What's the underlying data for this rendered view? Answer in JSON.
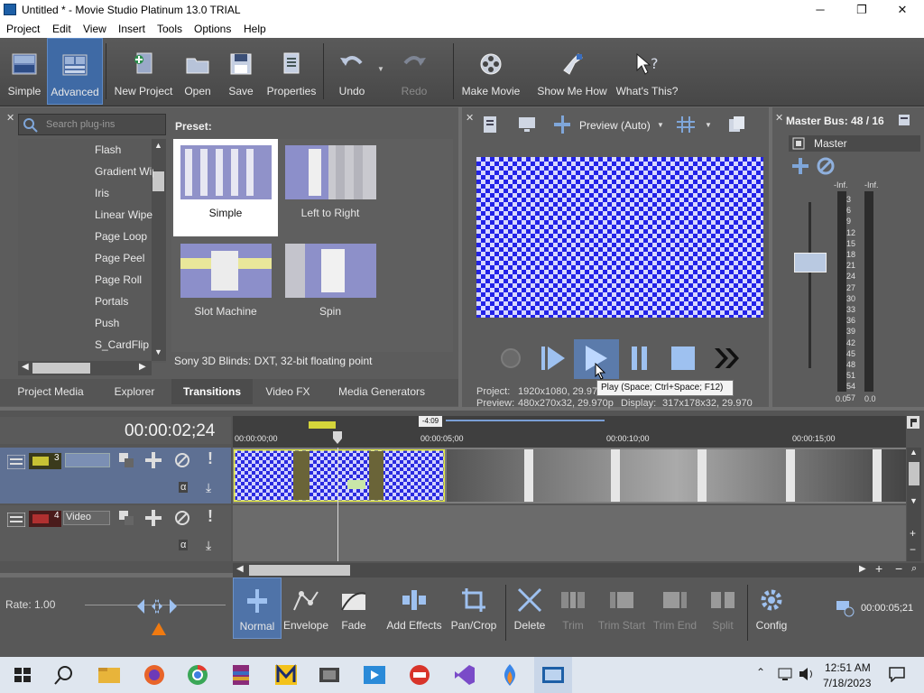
{
  "window": {
    "title": "Untitled * - Movie Studio Platinum 13.0 TRIAL",
    "minimize": "─",
    "maximize": "❐",
    "close": "✕"
  },
  "menu": [
    "Project",
    "Edit",
    "View",
    "Insert",
    "Tools",
    "Options",
    "Help"
  ],
  "toolbar": {
    "simple": "Simple",
    "advanced": "Advanced",
    "new_project": "New Project",
    "open": "Open",
    "save": "Save",
    "properties": "Properties",
    "undo": "Undo",
    "redo": "Redo",
    "make_movie": "Make Movie",
    "show_me_how": "Show Me How",
    "whats_this": "What's This?"
  },
  "plugins": {
    "search_placeholder": "Search plug-ins",
    "items": [
      "Flash",
      "Gradient Wip",
      "Iris",
      "Linear Wipe",
      "Page Loop",
      "Page Peel",
      "Page Roll",
      "Portals",
      "Push",
      "S_CardFlip"
    ]
  },
  "presets": {
    "label": "Preset:",
    "items": [
      "Simple",
      "Left to Right",
      "Slot Machine",
      "Spin"
    ],
    "status": "Sony 3D Blinds: DXT, 32-bit floating point"
  },
  "tabs": [
    "Project Media",
    "Explorer",
    "Transitions",
    "Video FX",
    "Media Generators"
  ],
  "preview": {
    "mode": "Preview (Auto)",
    "project_label": "Project:",
    "project_value": "1920x1080, 29.97",
    "preview_label": "Preview:",
    "preview_value": "480x270x32, 29.970p",
    "display_label": "Display:",
    "display_value": "317x178x32, 29.970",
    "tooltip": "Play (Space; Ctrl+Space; F12)"
  },
  "master": {
    "title": "Master Bus: 48 / 16",
    "label": "Master",
    "inf_left": "-Inf.",
    "inf_right": "-Inf.",
    "scale": [
      "3",
      "6",
      "9",
      "12",
      "15",
      "18",
      "21",
      "24",
      "27",
      "30",
      "33",
      "36",
      "39",
      "42",
      "45",
      "48",
      "51",
      "54",
      "57"
    ],
    "bottom_left": "0.0",
    "bottom_right": "0.0"
  },
  "timeline": {
    "timecode": "00:00:02;24",
    "marker": "-4:09",
    "ruler": [
      "00:00:00;00",
      "00:00:05;00",
      "00:00:10;00",
      "00:00:15;00"
    ],
    "track1_number": "3",
    "track2_number": "4",
    "track2_name": "Video",
    "rate": "Rate: 1.00",
    "end_time": "00:00:05;21"
  },
  "edit_tools": {
    "normal": "Normal",
    "envelope": "Envelope",
    "fade": "Fade",
    "add_effects": "Add Effects",
    "pan_crop": "Pan/Crop",
    "delete": "Delete",
    "trim": "Trim",
    "trim_start": "Trim Start",
    "trim_end": "Trim End",
    "split": "Split",
    "config": "Config"
  },
  "taskbar": {
    "time": "12:51 AM",
    "date": "7/18/2023"
  }
}
